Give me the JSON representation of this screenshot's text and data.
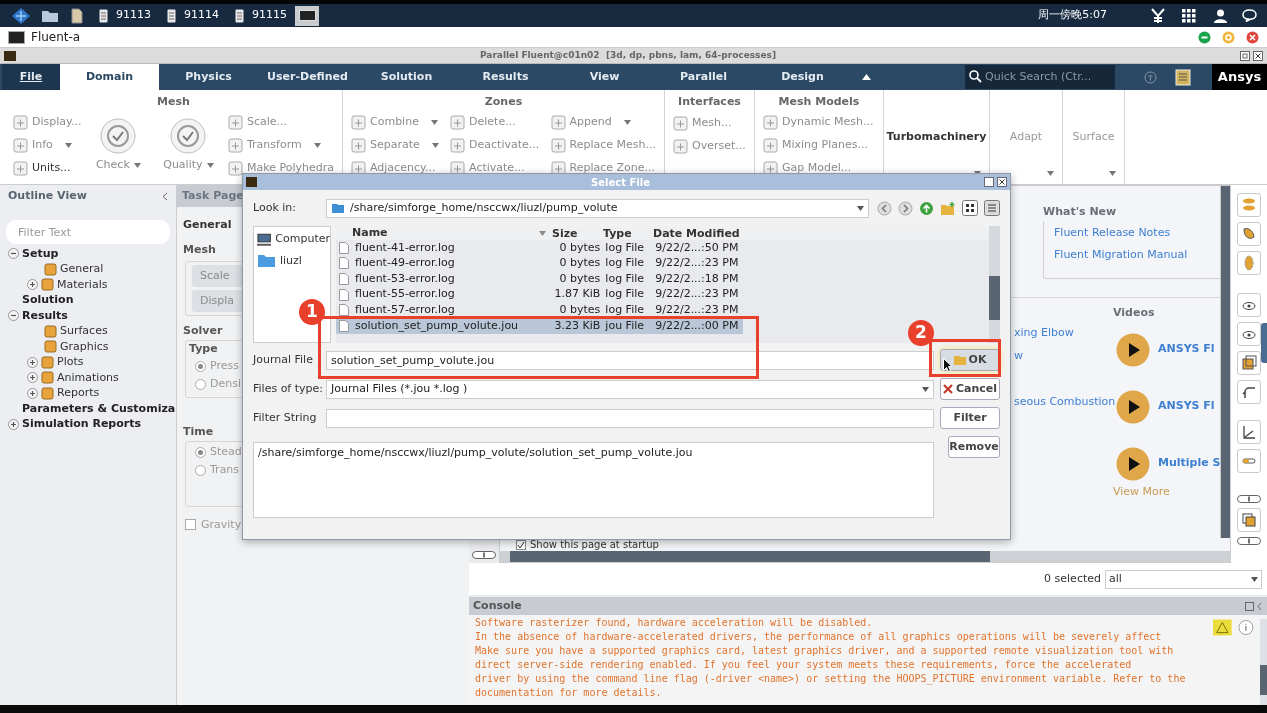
{
  "taskbar": {
    "items": [
      {
        "label": "91113"
      },
      {
        "label": "91114"
      },
      {
        "label": "91115"
      }
    ],
    "clock": "周一傍晚5:07"
  },
  "app_window": {
    "title": "Fluent-a"
  },
  "fluent_title": "Parallel Fluent@c01n02  [3d, dp, pbns, lam, 64-processes]",
  "tabs": [
    {
      "label": "File",
      "kind": "menu",
      "selected": false
    },
    {
      "label": "Domain",
      "kind": "tab",
      "selected": true
    },
    {
      "label": "Physics",
      "kind": "tab",
      "selected": false
    },
    {
      "label": "User-Defined",
      "kind": "tab",
      "selected": false
    },
    {
      "label": "Solution",
      "kind": "tab",
      "selected": false
    },
    {
      "label": "Results",
      "kind": "tab",
      "selected": false
    },
    {
      "label": "View",
      "kind": "tab",
      "selected": false
    },
    {
      "label": "Parallel",
      "kind": "tab",
      "selected": false
    },
    {
      "label": "Design",
      "kind": "tab",
      "selected": false
    }
  ],
  "quick_search": {
    "placeholder": "Quick Search (Ctr..."
  },
  "brand": "Ansys",
  "ribbon": [
    {
      "title": "Mesh",
      "columns": [
        [
          {
            "label": "Display...",
            "kind": "small",
            "disabled": true
          },
          {
            "label": "Info",
            "kind": "small",
            "disabled": true,
            "dropdown": true
          },
          {
            "label": "Units...",
            "kind": "small",
            "disabled": false
          }
        ],
        [
          {
            "label": "Check",
            "kind": "large",
            "disabled": true,
            "dropdown": true
          }
        ],
        [
          {
            "label": "Quality",
            "kind": "large",
            "disabled": true,
            "dropdown": true
          }
        ],
        [
          {
            "label": "Scale...",
            "kind": "small",
            "disabled": true
          },
          {
            "label": "Transform",
            "kind": "small",
            "disabled": true,
            "dropdown": true
          },
          {
            "label": "Make Polyhedra",
            "kind": "small",
            "disabled": true
          }
        ]
      ]
    },
    {
      "title": "Zones",
      "columns": [
        [
          {
            "label": "Combine",
            "kind": "small",
            "disabled": true,
            "dropdown": true
          },
          {
            "label": "Separate",
            "kind": "small",
            "disabled": true,
            "dropdown": true
          },
          {
            "label": "Adjacency...",
            "kind": "small",
            "disabled": true
          }
        ],
        [
          {
            "label": "Delete...",
            "kind": "small",
            "disabled": true
          },
          {
            "label": "Deactivate...",
            "kind": "small",
            "disabled": true
          },
          {
            "label": "Activate...",
            "kind": "small",
            "disabled": true
          }
        ],
        [
          {
            "label": "Append",
            "kind": "small",
            "disabled": true,
            "dropdown": true
          },
          {
            "label": "Replace Mesh...",
            "kind": "small",
            "disabled": true
          },
          {
            "label": "Replace Zone...",
            "kind": "small",
            "disabled": true
          }
        ]
      ]
    },
    {
      "title": "Interfaces",
      "columns": [
        [
          {
            "label": "Mesh...",
            "kind": "small",
            "disabled": true
          },
          {
            "label": "Overset...",
            "kind": "small",
            "disabled": true
          }
        ]
      ]
    },
    {
      "title": "Mesh Models",
      "columns": [
        [
          {
            "label": "Dynamic Mesh...",
            "kind": "small",
            "disabled": true
          },
          {
            "label": "Mixing Planes...",
            "kind": "small",
            "disabled": true
          },
          {
            "label": "Gap Model...",
            "kind": "small",
            "disabled": true
          }
        ]
      ]
    },
    {
      "columns": [
        [
          {
            "label": "Turbomachinery",
            "kind": "text",
            "disabled": false,
            "dropdown": true
          }
        ]
      ]
    },
    {
      "columns": [
        [
          {
            "label": "Adapt",
            "kind": "text",
            "disabled": true,
            "dropdown": true
          }
        ]
      ]
    },
    {
      "columns": [
        [
          {
            "label": "Surface",
            "kind": "text",
            "disabled": true,
            "dropdown": true
          }
        ]
      ]
    }
  ],
  "outline": {
    "title": "Outline View",
    "filter": {
      "placeholder": "Filter Text"
    },
    "tree": [
      {
        "label": "Setup",
        "expanded": true,
        "children": [
          {
            "label": "General"
          },
          {
            "label": "Materials",
            "expanded": false
          }
        ]
      },
      {
        "label": "Solution"
      },
      {
        "label": "Results",
        "expanded": true,
        "children": [
          {
            "label": "Surfaces"
          },
          {
            "label": "Graphics"
          },
          {
            "label": "Plots",
            "expanded": false
          },
          {
            "label": "Animations",
            "expanded": false
          },
          {
            "label": "Reports",
            "expanded": false
          }
        ]
      },
      {
        "label": "Parameters & Customiza"
      },
      {
        "label": "Simulation Reports",
        "expanded": false
      }
    ]
  },
  "task_page": {
    "title": "Task Page",
    "heading": "General",
    "mesh": {
      "title": "Mesh",
      "buttons": [
        "Scale",
        "Displa"
      ]
    },
    "solver": {
      "title": "Solver",
      "type": {
        "title": "Type",
        "options": [
          {
            "label": "Press",
            "selected": true
          },
          {
            "label": "Densi",
            "selected": false
          }
        ]
      },
      "time": {
        "title": "Time",
        "options": [
          {
            "label": "Stead",
            "selected": true
          },
          {
            "label": "Trans",
            "selected": false
          }
        ]
      }
    },
    "gravity": {
      "label": "Gravity",
      "checked": false
    }
  },
  "start_page": {
    "whats_new": {
      "title": "What's New",
      "links": [
        "Fluent Release Notes",
        "Fluent Migration Manual"
      ]
    },
    "tutorial_links": [
      "xing Elbow",
      "w",
      "seous Combustion"
    ],
    "videos": {
      "title": "Videos",
      "items": [
        "ANSYS Fl",
        "ANSYS Fl",
        "Multiple S"
      ],
      "more": "View More"
    },
    "show_at_startup": {
      "label": "Show this page at startup",
      "checked": true
    }
  },
  "selection": {
    "count": "0 selected",
    "filter": "all"
  },
  "console": {
    "title": "Console",
    "lines": [
      "Software rasterizer found, hardware acceleration will be disabled.",
      "In the absence of hardware-accelerated drivers, the performance of all graphics operations will be severely affect",
      "Make sure you have a supported graphics card, latest graphics driver, and a supported remote visualization tool with",
      "direct server-side rendering enabled. If you feel your system meets these requirements, force the accelerated",
      "driver by using the command line flag (-driver <name>) or setting the HOOPS_PICTURE environment variable. Refer to the",
      "documentation for more details."
    ]
  },
  "dialog": {
    "title": "Select File",
    "look_in": {
      "label": "Look in:",
      "value": "/share/simforge_home/nsccwx/liuzl/pump_volute"
    },
    "places": [
      {
        "label": "Computer",
        "kind": "computer"
      },
      {
        "label": "liuzl",
        "kind": "folder"
      }
    ],
    "file_list": {
      "columns": [
        "Name",
        "Size",
        "Type",
        "Date Modified"
      ],
      "rows": [
        {
          "name": "fluent-41-error.log",
          "size": "0 bytes",
          "type": "log File",
          "date": "9/22/2...:50 PM",
          "selected": false
        },
        {
          "name": "fluent-49-error.log",
          "size": "0 bytes",
          "type": "log File",
          "date": "9/22/2...:23 PM",
          "selected": false
        },
        {
          "name": "fluent-53-error.log",
          "size": "0 bytes",
          "type": "log File",
          "date": "9/22/2...:18 PM",
          "selected": false
        },
        {
          "name": "fluent-55-error.log",
          "size": "1.87 KiB",
          "type": "log File",
          "date": "9/22/2...:23 PM",
          "selected": false
        },
        {
          "name": "fluent-57-error.log",
          "size": "0 bytes",
          "type": "log File",
          "date": "9/22/2...:23 PM",
          "selected": false
        },
        {
          "name": "solution_set_pump_volute.jou",
          "size": "3.23 KiB",
          "type": "jou File",
          "date": "9/22/2...:00 PM",
          "selected": true
        }
      ]
    },
    "journal_file": {
      "label": "Journal File",
      "value": "solution_set_pump_volute.jou"
    },
    "files_of_type": {
      "label": "Files of type:",
      "value": "Journal Files (*.jou *.log )"
    },
    "filter_string": {
      "label": "Filter String"
    },
    "buttons": [
      {
        "label": "OK",
        "kind": "ok"
      },
      {
        "label": "Cancel",
        "kind": "cancel"
      },
      {
        "label": "Filter",
        "kind": "plain"
      },
      {
        "label": "Remove",
        "kind": "plain"
      }
    ],
    "selected_files": [
      "/share/simforge_home/nsccwx/liuzl/pump_volute/solution_set_pump_volute.jou"
    ]
  },
  "annotations": [
    {
      "label": "1"
    },
    {
      "label": "2"
    }
  ]
}
